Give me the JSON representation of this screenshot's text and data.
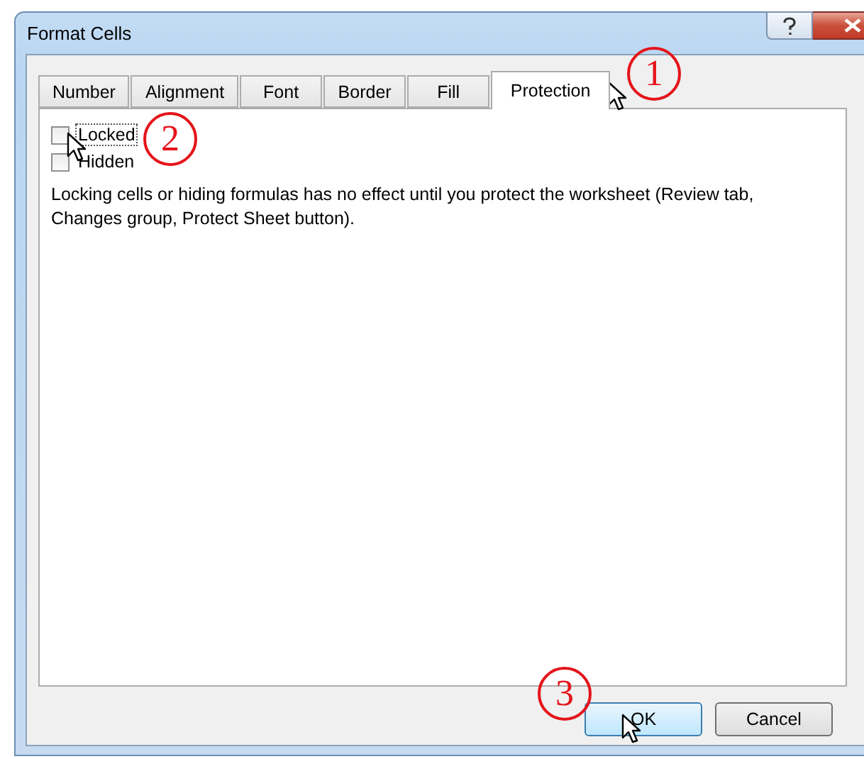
{
  "window": {
    "title": "Format Cells"
  },
  "tabs": [
    {
      "label": "Number",
      "selected": false
    },
    {
      "label": "Alignment",
      "selected": false
    },
    {
      "label": "Font",
      "selected": false
    },
    {
      "label": "Border",
      "selected": false
    },
    {
      "label": "Fill",
      "selected": false
    },
    {
      "label": "Protection",
      "selected": true
    }
  ],
  "checkboxes": [
    {
      "label": "Locked",
      "checked": false,
      "focused": true
    },
    {
      "label": "Hidden",
      "checked": false,
      "focused": false
    }
  ],
  "note": "Locking cells or hiding formulas has no effect until you protect the worksheet (Review tab, Changes group, Protect Sheet button).",
  "buttons": [
    {
      "label": "OK",
      "default": true
    },
    {
      "label": "Cancel",
      "default": false
    }
  ],
  "annotations": [
    {
      "label": "1"
    },
    {
      "label": "2"
    },
    {
      "label": "3"
    }
  ]
}
